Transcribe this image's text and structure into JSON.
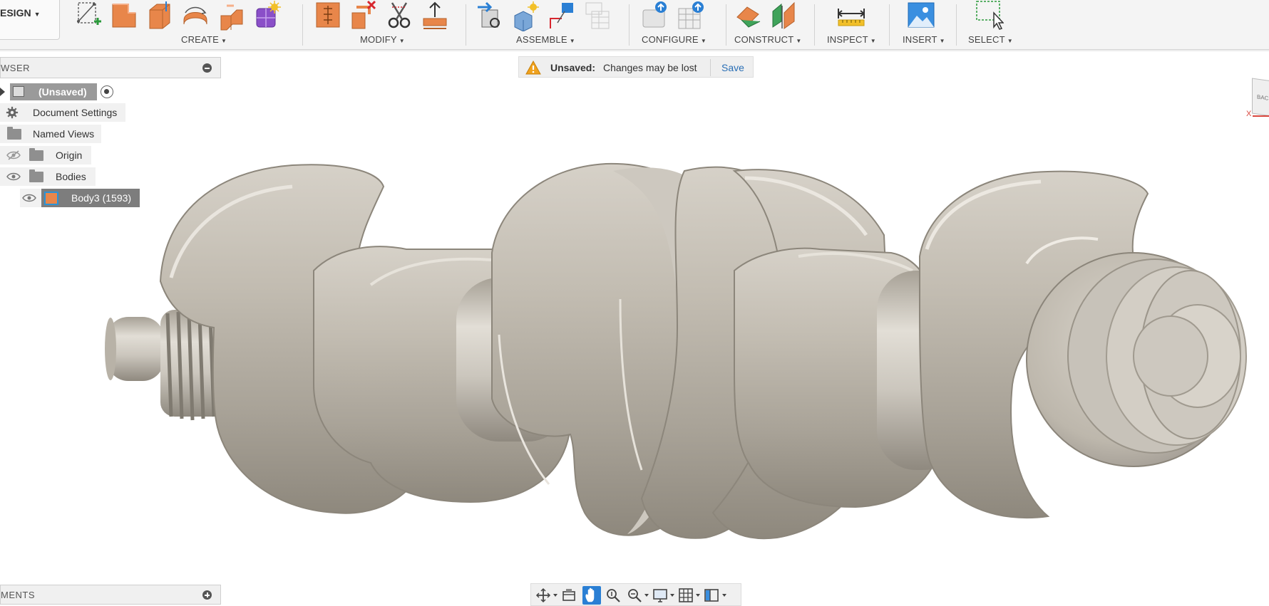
{
  "toolbar": {
    "workspace_label": "ESIGN",
    "groups": [
      {
        "label": "CREATE"
      },
      {
        "label": "MODIFY"
      },
      {
        "label": "ASSEMBLE"
      },
      {
        "label": "CONFIGURE"
      },
      {
        "label": "CONSTRUCT"
      },
      {
        "label": "INSPECT"
      },
      {
        "label": "INSERT"
      },
      {
        "label": "SELECT"
      }
    ]
  },
  "browser": {
    "title": "WSER",
    "root_label": "(Unsaved)",
    "items": [
      {
        "label": "Document Settings",
        "icon": "gear-icon"
      },
      {
        "label": "Named Views",
        "icon": "folder-icon"
      },
      {
        "label": "Origin",
        "icon": "folder-icon",
        "visible": false
      },
      {
        "label": "Bodies",
        "icon": "folder-icon",
        "visible": true
      },
      {
        "label": "Body3 (1593)",
        "icon": "body-icon",
        "visible": true,
        "selected": true
      }
    ]
  },
  "banner": {
    "title": "Unsaved:",
    "message": "Changes may be lost",
    "action": "Save"
  },
  "viewcube": {
    "face": "BACK",
    "axis": "X"
  },
  "comments": {
    "title": "MENTS"
  },
  "colors": {
    "accent_blue": "#2a7fd4",
    "warning": "#f0a21e",
    "link": "#2a6fb5",
    "create_orange": "#e8864a"
  }
}
